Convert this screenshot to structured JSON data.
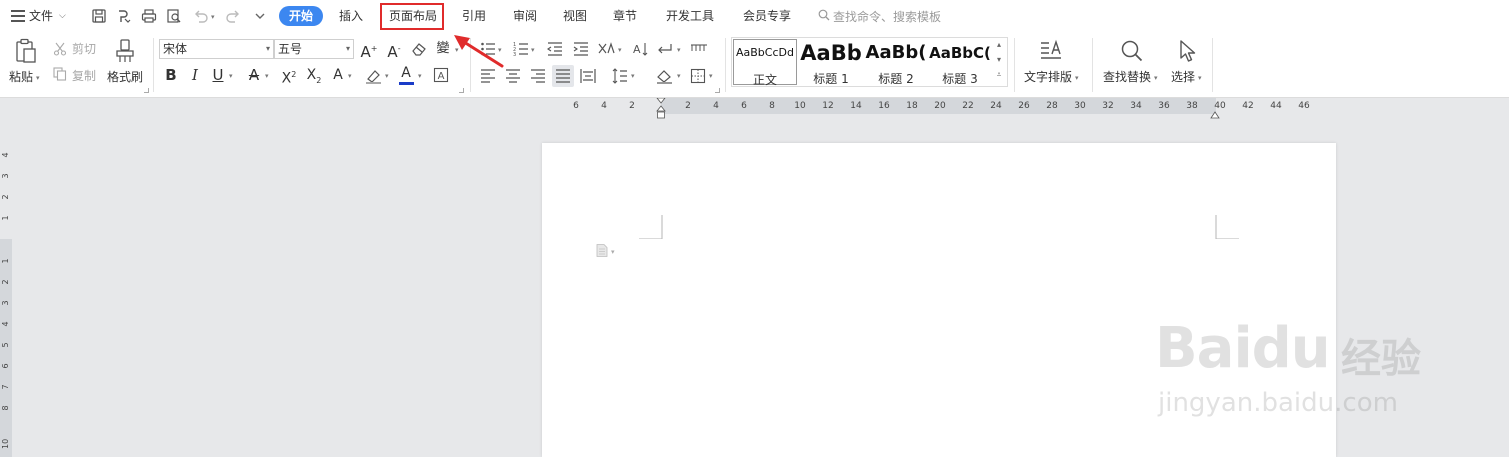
{
  "menubar": {
    "file_label": "文件",
    "tabs": [
      "开始",
      "插入",
      "页面布局",
      "引用",
      "审阅",
      "视图",
      "章节",
      "开发工具",
      "会员专享"
    ],
    "search_placeholder": "查找命令、搜索模板"
  },
  "ribbon": {
    "paste": "粘贴",
    "cut": "剪切",
    "copy": "复制",
    "format_painter": "格式刷",
    "font_name": "宋体",
    "font_size": "五号",
    "styles": [
      {
        "sample": "AaBbCcDd",
        "name": "正文"
      },
      {
        "sample": "AaBb",
        "name": "标题 1"
      },
      {
        "sample": "AaBb(",
        "name": "标题 2"
      },
      {
        "sample": "AaBbC(",
        "name": "标题 3"
      }
    ],
    "text_layout": "文字排版",
    "find_replace": "查找替换",
    "select": "选择"
  },
  "ruler": {
    "h_ticks": [
      "6",
      "4",
      "2",
      "2",
      "4",
      "6",
      "8",
      "10",
      "12",
      "14",
      "16",
      "18",
      "20",
      "22",
      "24",
      "26",
      "28",
      "30",
      "32",
      "34",
      "36",
      "38",
      "40",
      "42",
      "44",
      "46"
    ],
    "v_ticks": [
      "4",
      "3",
      "2",
      "1",
      "1",
      "2",
      "3",
      "4",
      "5",
      "6",
      "7",
      "8",
      "10"
    ]
  },
  "watermark": {
    "brand": "Baidu",
    "cn": "经验",
    "url": "jingyan.baidu.com"
  },
  "colors": {
    "accent": "#3c87f0",
    "highlight_box": "#e02b2b",
    "font_color_underline": "#1a3cc8"
  }
}
